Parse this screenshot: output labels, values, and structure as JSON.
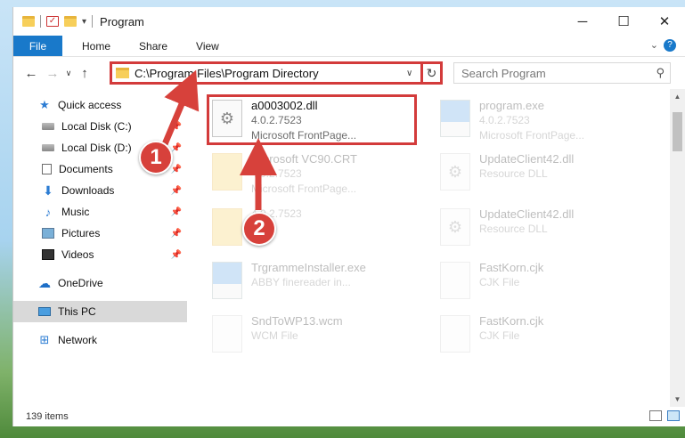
{
  "window": {
    "title": "Program",
    "controls": [
      "minimize",
      "maximize",
      "close"
    ]
  },
  "ribbon": {
    "file_label": "File",
    "tabs": [
      "Home",
      "Share",
      "View"
    ],
    "help": "?"
  },
  "navigation": {
    "back_icon": "arrow-left-icon",
    "forward_icon": "arrow-right-icon",
    "recent_icon": "chevron-down-icon",
    "up_icon": "arrow-up-icon",
    "address": "C:\\Program Files\\Program Directory",
    "search_placeholder": "Search Program"
  },
  "sidebar": {
    "items": [
      {
        "label": "Quick access",
        "icon": "star-icon"
      },
      {
        "label": "Local Disk (C:)",
        "icon": "disk-icon",
        "pinned": true
      },
      {
        "label": "Local Disk (D:)",
        "icon": "disk-icon",
        "pinned": true
      },
      {
        "label": "Documents",
        "icon": "documents-icon",
        "pinned": true
      },
      {
        "label": "Downloads",
        "icon": "downloads-icon",
        "pinned": true
      },
      {
        "label": "Music",
        "icon": "music-icon",
        "pinned": true
      },
      {
        "label": "Pictures",
        "icon": "pictures-icon",
        "pinned": true
      },
      {
        "label": "Videos",
        "icon": "videos-icon",
        "pinned": true
      },
      {
        "label": "OneDrive",
        "icon": "onedrive-icon"
      },
      {
        "label": "This PC",
        "icon": "pc-icon",
        "selected": true
      },
      {
        "label": "Network",
        "icon": "network-icon"
      }
    ]
  },
  "files": [
    {
      "name": "a0003002.dll",
      "line2": "4.0.2.7523",
      "line3": "Microsoft FrontPage...",
      "highlighted": true
    },
    {
      "name": "program.exe",
      "line2": "4.0.2.7523",
      "line3": "Microsoft FrontPage..."
    },
    {
      "name": "Microsoft VC90.CRT",
      "line2": "4.0.2.7523",
      "line3": "Microsoft FrontPage..."
    },
    {
      "name": "UpdateClient42.dll",
      "line2": "Resource DLL",
      "line3": ""
    },
    {
      "name": "",
      "line2": "4.0.2.7523",
      "line3": ""
    },
    {
      "name": "UpdateClient42.dll",
      "line2": "Resource DLL",
      "line3": ""
    },
    {
      "name": "TrgrammeInstaller.exe",
      "line2": "ABBY finereader in...",
      "line3": ""
    },
    {
      "name": "FastKorn.cjk",
      "line2": "CJK File",
      "line3": ""
    },
    {
      "name": "SndToWP13.wcm",
      "line2": "WCM File",
      "line3": ""
    },
    {
      "name": "FastKorn.cjk",
      "line2": "CJK File",
      "line3": ""
    }
  ],
  "status": {
    "item_count": "139 items"
  },
  "annotations": {
    "step1": "1",
    "step2": "2",
    "color": "#d7413b"
  }
}
